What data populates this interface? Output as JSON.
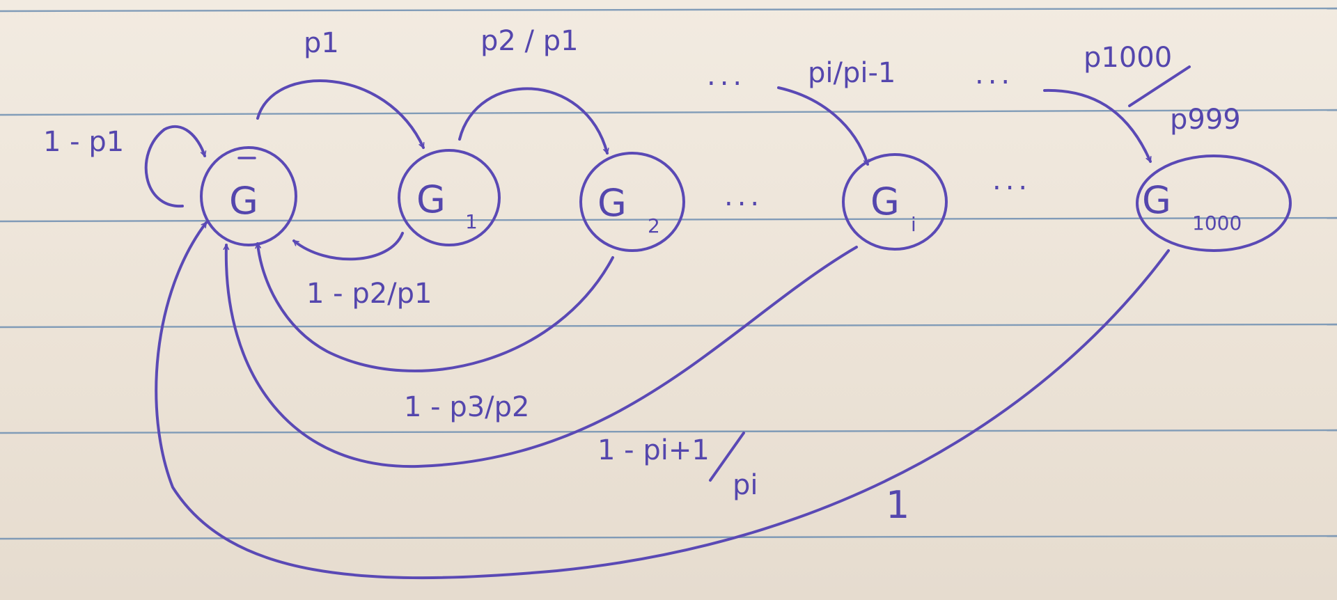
{
  "nodes": {
    "g_bar": {
      "main": "G",
      "sub": ""
    },
    "g1": {
      "main": "G",
      "sub": "1"
    },
    "g2": {
      "main": "G",
      "sub": "2"
    },
    "gi": {
      "main": "G",
      "sub": "i"
    },
    "g1000": {
      "main": "G",
      "sub": "1000"
    }
  },
  "edges": {
    "self_loop": "1 - p1",
    "g_to_g1": "p1",
    "g1_to_g2": "p2 / p1",
    "to_gi": "pi/pi-1",
    "to_g1000_top": "p1000",
    "to_g1000_bottom": "p999",
    "g1_back": "1 - p2/p1",
    "g2_back": "1 - p3/p2",
    "gi_back_top": "1 - pi+1",
    "gi_back_bottom": "pi",
    "g1000_back": "1"
  },
  "ellipsis": "...",
  "colors": {
    "ink": "#5a49b5",
    "paper": "#efe7dc",
    "rule": "#6e8fb2"
  }
}
